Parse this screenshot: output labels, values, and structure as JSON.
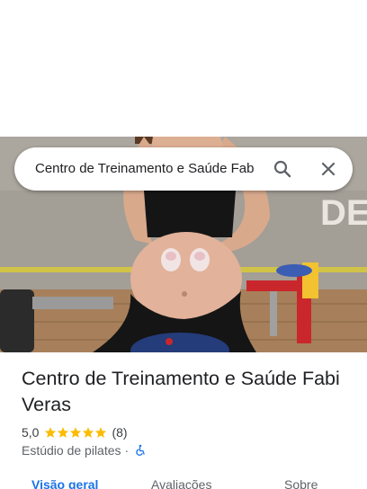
{
  "search": {
    "query": "Centro de Treinamento e Saúde Fab"
  },
  "hero": {
    "wall_text": "DE"
  },
  "place": {
    "title": "Centro de Treinamento e Saúde Fabi Veras",
    "rating": "5,0",
    "stars": 5,
    "review_count": "(8)",
    "category": "Estúdio de pilates",
    "separator": "·"
  },
  "tabs": [
    {
      "label": "Visão geral",
      "active": true
    },
    {
      "label": "Avaliações",
      "active": false
    },
    {
      "label": "Sobre",
      "active": false
    }
  ],
  "colors": {
    "accent": "#1a73e8",
    "star": "#fbbc04"
  }
}
